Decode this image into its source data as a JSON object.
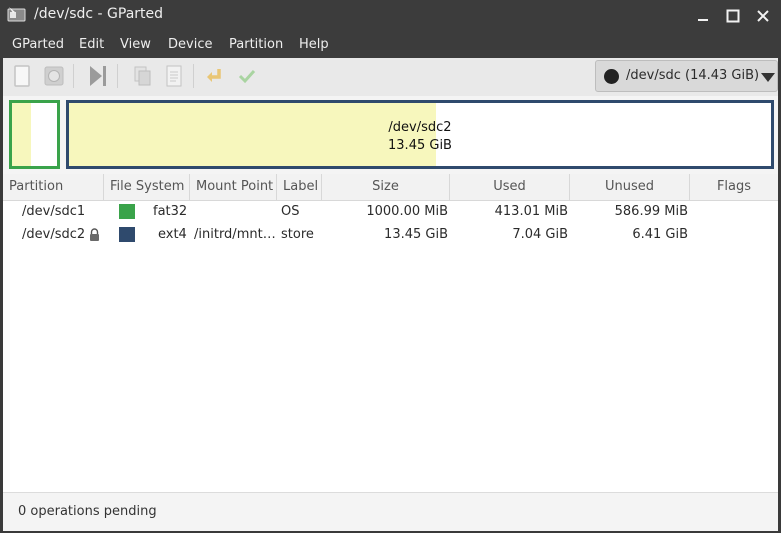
{
  "window": {
    "title": "/dev/sdc - GParted"
  },
  "menu": {
    "items": [
      "GParted",
      "Edit",
      "View",
      "Device",
      "Partition",
      "Help"
    ]
  },
  "toolbar": {
    "buttons": [
      "new-icon",
      "delete-icon",
      "resize-move-icon",
      "copy-icon",
      "paste-icon",
      "undo-icon",
      "apply-icon"
    ],
    "device_label": "/dev/sdc (14.43 GiB)"
  },
  "diskmap": {
    "partitions": [
      {
        "color": "#3aa34a",
        "used_fraction": 0.41
      },
      {
        "name": "/dev/sdc2",
        "size": "13.45 GiB",
        "color": "#2f4a6d",
        "used_fraction": 0.52
      }
    ]
  },
  "table": {
    "headers": [
      "Partition",
      "File System",
      "Mount Point",
      "Label",
      "Size",
      "Used",
      "Unused",
      "Flags"
    ],
    "rows": [
      {
        "partition": "/dev/sdc1",
        "locked": false,
        "fs_color": "#3aa34a",
        "filesystem": "fat32",
        "mount_point": "",
        "label": "OS",
        "size": "1000.00 MiB",
        "used": "413.01 MiB",
        "unused": "586.99 MiB",
        "flags": ""
      },
      {
        "partition": "/dev/sdc2",
        "locked": true,
        "fs_color": "#2f4a6d",
        "filesystem": "ext4",
        "mount_point": "/initrd/mnt…",
        "label": "store",
        "size": "13.45 GiB",
        "used": "7.04 GiB",
        "unused": "6.41 GiB",
        "flags": ""
      }
    ]
  },
  "status": {
    "text": "0 operations pending"
  }
}
